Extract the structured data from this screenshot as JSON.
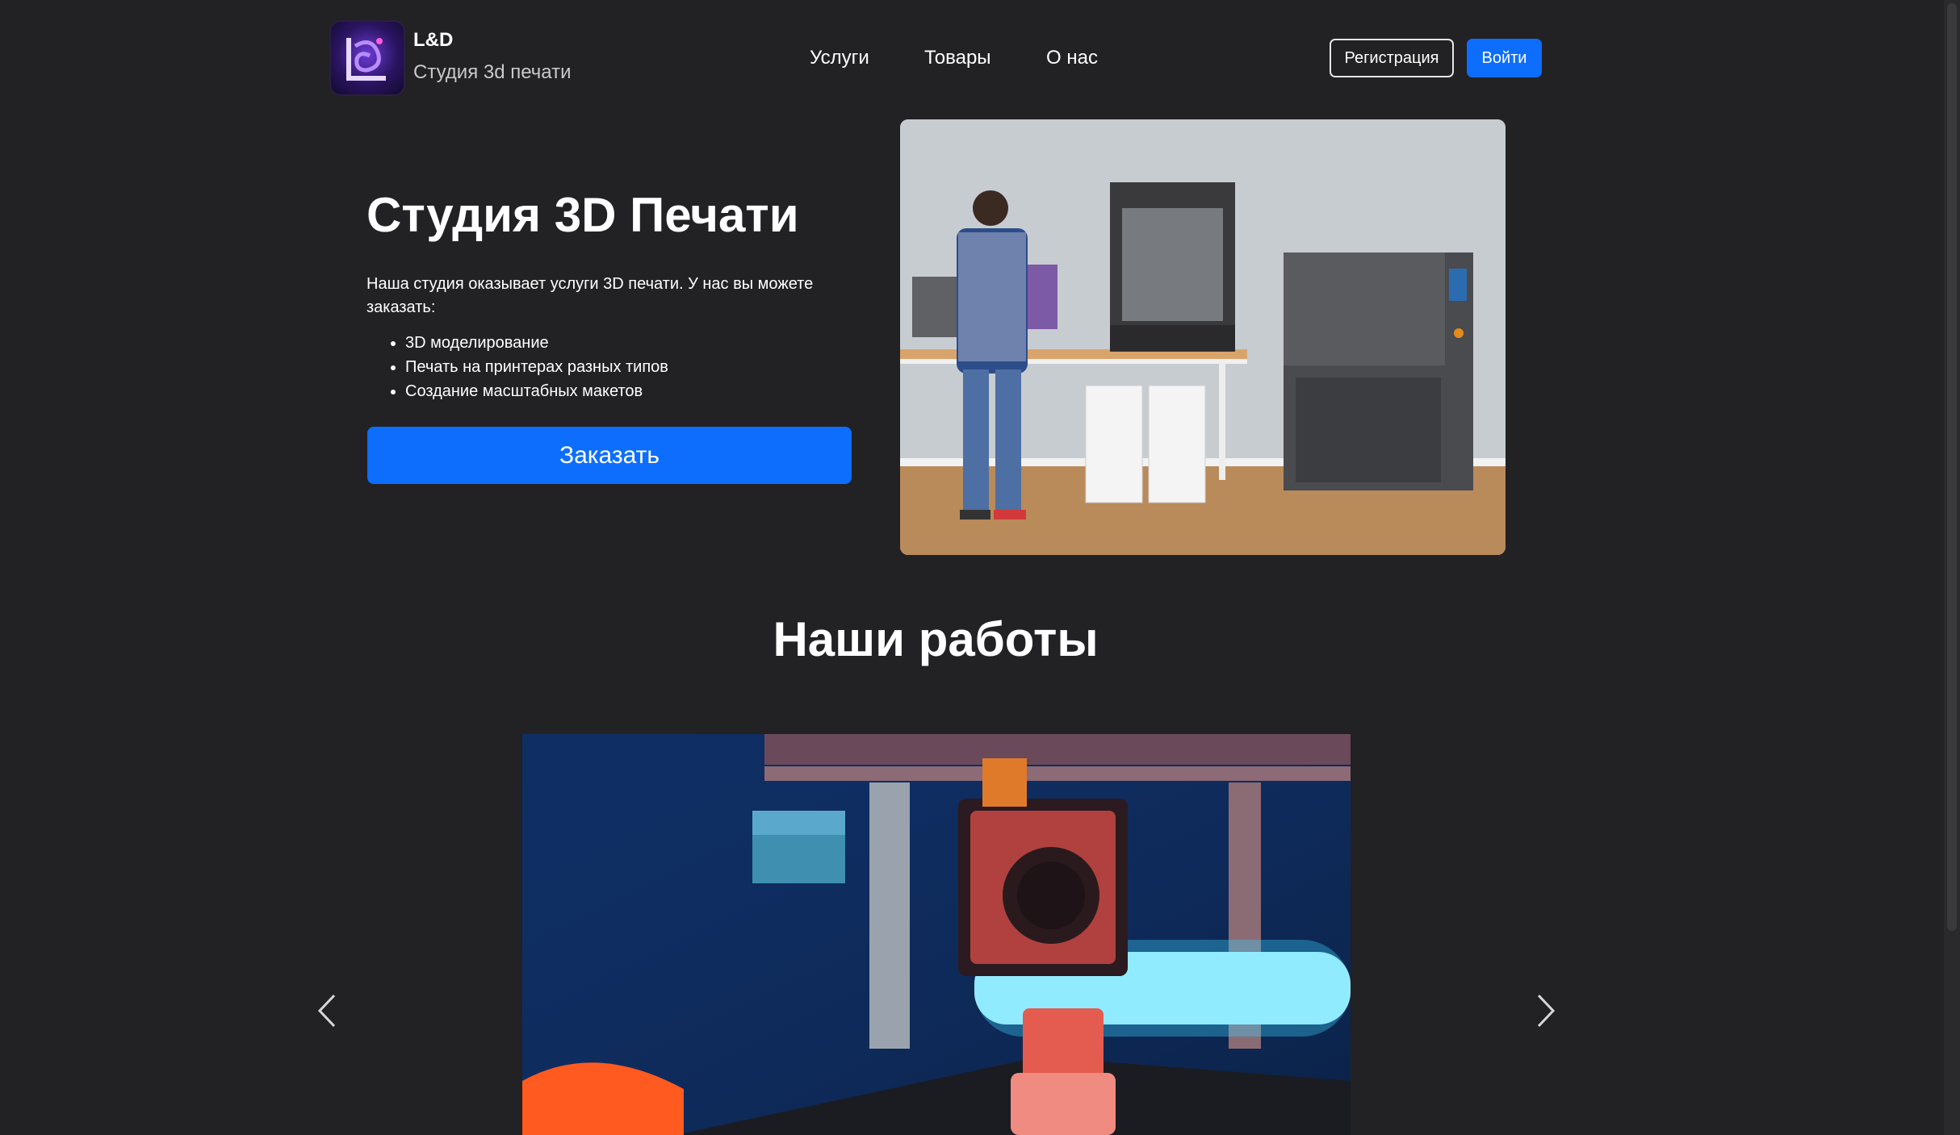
{
  "header": {
    "brand_name": "L&D",
    "brand_subtitle": "Студия 3d печати",
    "nav": [
      "Услуги",
      "Товары",
      "О нас"
    ],
    "register_label": "Регистрация",
    "login_label": "Войти"
  },
  "hero": {
    "title": "Студия 3D Печати",
    "description": "Наша студия оказывает услуги 3D печати. У нас вы можете заказать:",
    "services": [
      "3D моделирование",
      "Печать на принтерах разных типов",
      "Создание масштабных макетов"
    ],
    "order_label": "Заказать"
  },
  "works": {
    "title": "Наши работы"
  },
  "colors": {
    "background": "#222123",
    "accent": "#0d6efd",
    "text": "#ffffff"
  }
}
